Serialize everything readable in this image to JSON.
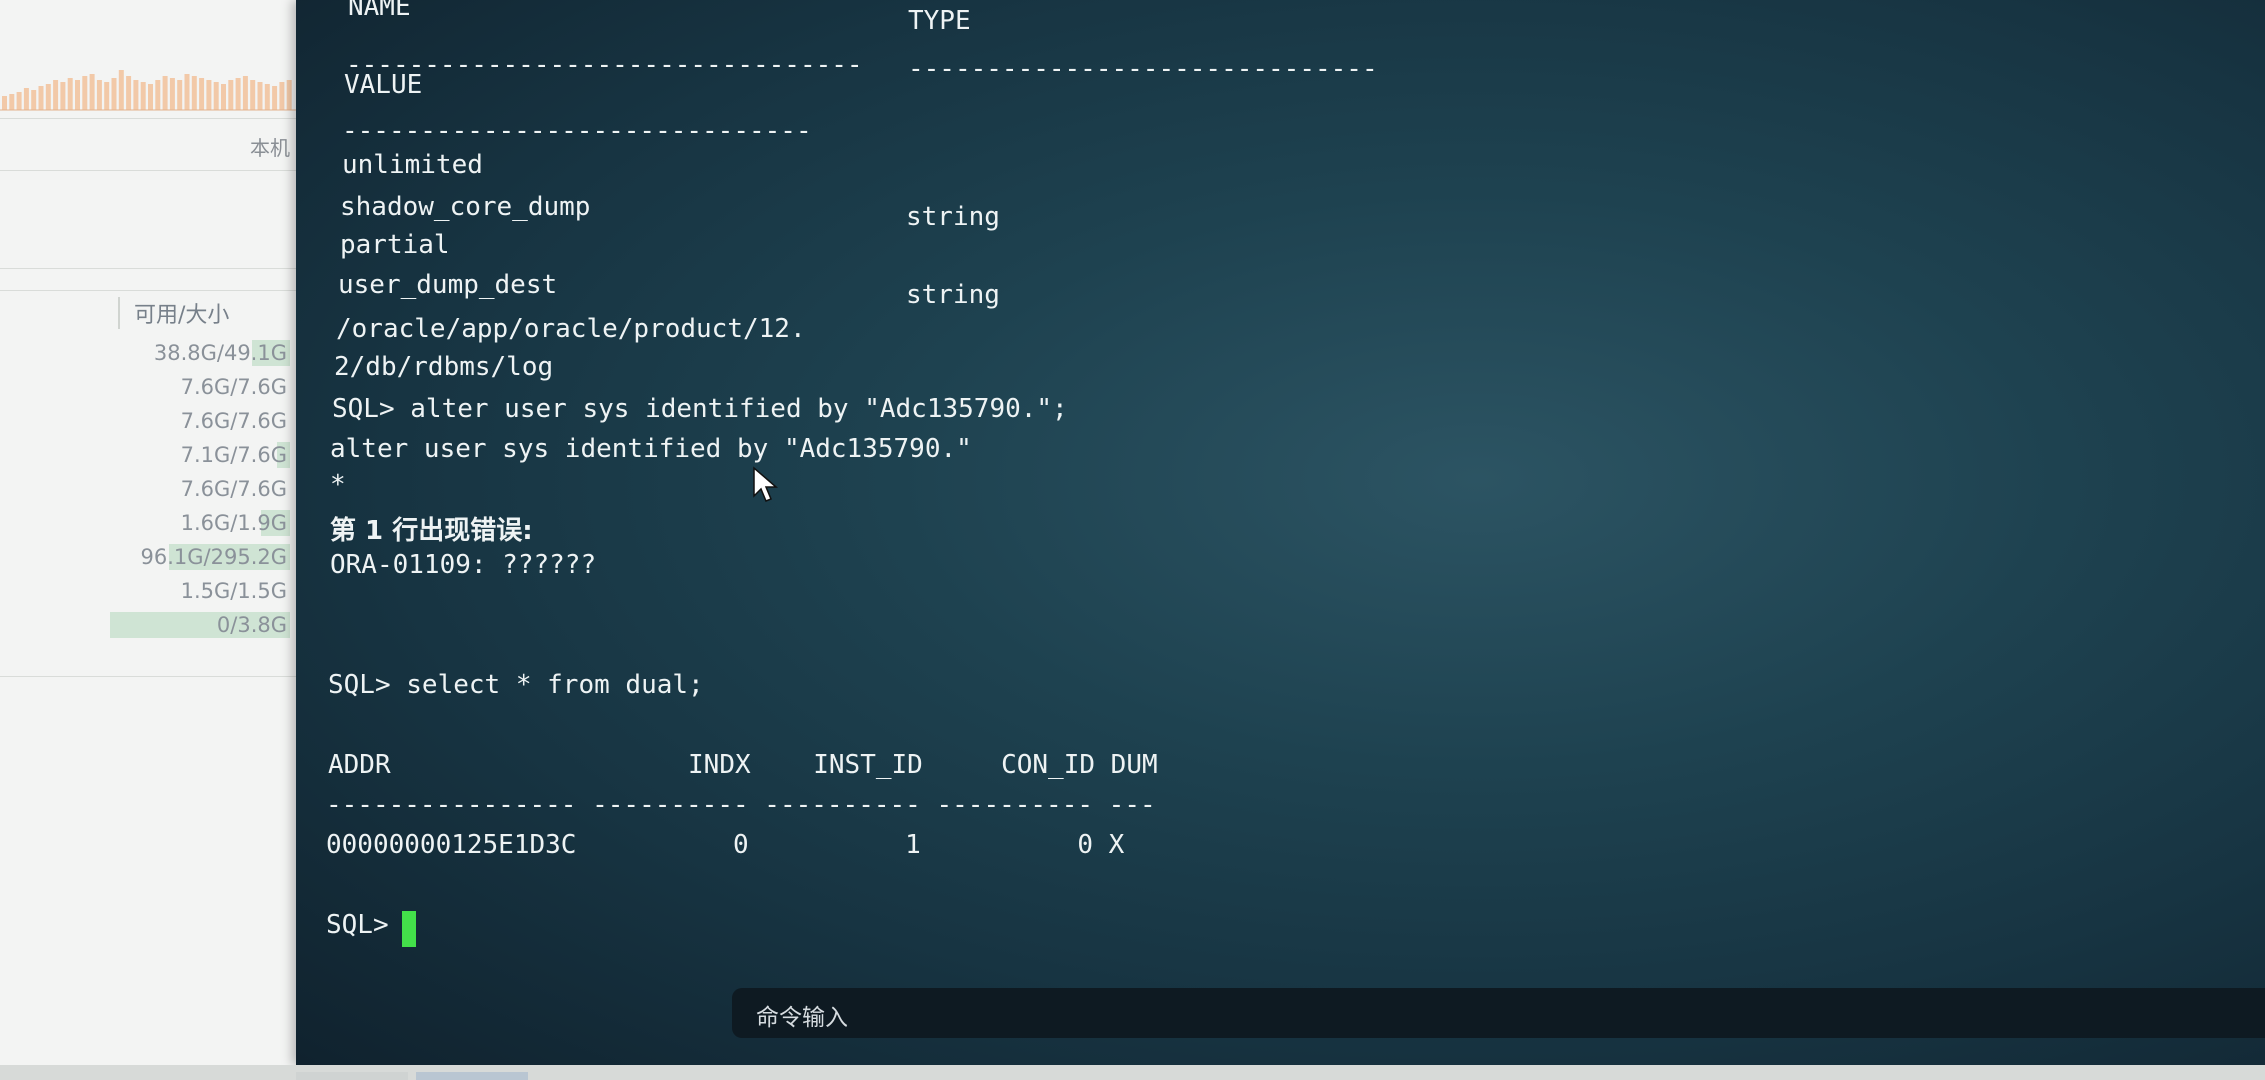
{
  "sidebar": {
    "bench_label": "本机",
    "disk_header": "可用/大小",
    "disks": [
      {
        "value": "38.8G/49.1G",
        "used_fraction": 0.21
      },
      {
        "value": "7.6G/7.6G",
        "used_fraction": 0.0
      },
      {
        "value": "7.6G/7.6G",
        "used_fraction": 0.0
      },
      {
        "value": "7.1G/7.6G",
        "used_fraction": 0.07
      },
      {
        "value": "7.6G/7.6G",
        "used_fraction": 0.0
      },
      {
        "value": "1.6G/1.9G",
        "used_fraction": 0.16
      },
      {
        "value": "96.1G/295.2G",
        "used_fraction": 0.67
      },
      {
        "value": "1.5G/1.5G",
        "used_fraction": 0.0
      },
      {
        "value": "0/3.8G",
        "used_fraction": 1.0
      }
    ]
  },
  "terminal": {
    "header_name": "NAME",
    "header_type": "TYPE",
    "dash_name": "---------------------------------",
    "dash_type": "------------------------------",
    "header_value": "VALUE",
    "dash_value": "------------------------------",
    "line_unlimited": "unlimited",
    "param1_name": "shadow_core_dump",
    "param1_type": "string",
    "param1_value": "partial",
    "param2_name": "user_dump_dest",
    "param2_type": "string",
    "param2_value_1": "/oracle/app/oracle/product/12.",
    "param2_value_2": "2/db/rdbms/log",
    "cmd1": "SQL> alter user sys identified by \"Adc135790.\";",
    "echo1": "alter user sys identified by \"Adc135790.\"",
    "marker": "*",
    "error_cn": "第 1 行出现错误:",
    "error_code": "ORA-01109: ??????",
    "cmd2": "SQL> select * from dual;",
    "table_header": "ADDR                   INDX    INST_ID     CON_ID DUM",
    "table_dashes": "---------------- ---------- ---------- ---------- ---",
    "table_row": "00000000125E1D3C          0          1          0 X",
    "prompt": "SQL> "
  },
  "command_bar": {
    "label": "命令输入"
  },
  "colors": {
    "cursor": "#43e04a",
    "disk_fill": "#cfe4d4"
  }
}
